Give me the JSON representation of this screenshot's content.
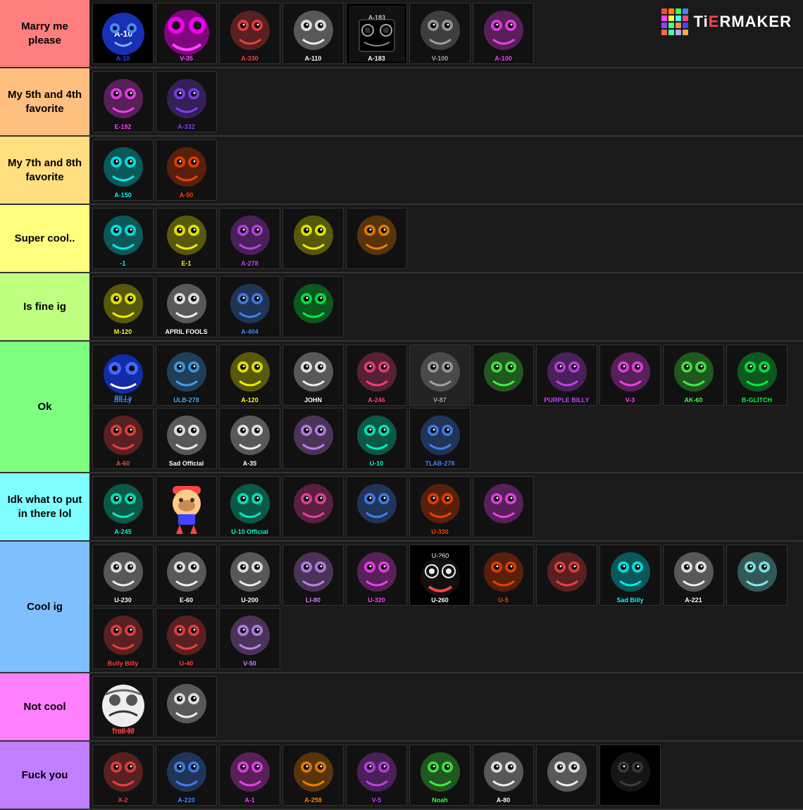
{
  "logo": {
    "text": "TiERMAKER",
    "highlight": "T"
  },
  "tiers": [
    {
      "id": "marry",
      "label": "Marry me please",
      "color": "#ff7f7f",
      "items": [
        {
          "id": "a10",
          "label": "A-10",
          "color": "#2244ff",
          "bg": "#000"
        },
        {
          "id": "v35",
          "label": "V-35",
          "color": "#ff44ff",
          "bg": "#111"
        },
        {
          "id": "a330",
          "label": "A-330",
          "color": "#ff4444",
          "bg": "#111"
        },
        {
          "id": "a110",
          "label": "A-110",
          "color": "#ffffff",
          "bg": "#111"
        },
        {
          "id": "a183",
          "label": "A-183",
          "color": "#ffffff",
          "bg": "#000"
        },
        {
          "id": "v100b",
          "label": "V-100",
          "color": "#aaaaaa",
          "bg": "#111"
        },
        {
          "id": "a100",
          "label": "A-100",
          "color": "#ff44ff",
          "bg": "#111"
        }
      ]
    },
    {
      "id": "5th4th",
      "label": "My 5th and 4th favorite",
      "color": "#ffbf7f",
      "items": [
        {
          "id": "e192",
          "label": "E-192",
          "color": "#ff44ff",
          "bg": "#111"
        },
        {
          "id": "a332",
          "label": "A-332",
          "color": "#8844ff",
          "bg": "#111"
        }
      ]
    },
    {
      "id": "7th8th",
      "label": "My 7th and 8th favorite",
      "color": "#ffdf80",
      "items": [
        {
          "id": "a150",
          "label": "A-150",
          "color": "#00ffff",
          "bg": "#111"
        },
        {
          "id": "a50",
          "label": "A-50",
          "color": "#ff4400",
          "bg": "#111"
        }
      ]
    },
    {
      "id": "supercool",
      "label": "Super cool..",
      "color": "#ffff7f",
      "items": [
        {
          "id": "neg1",
          "label": "-1",
          "color": "#00ffff",
          "bg": "#111"
        },
        {
          "id": "e1",
          "label": "E-1",
          "color": "#ffff00",
          "bg": "#111"
        },
        {
          "id": "a278",
          "label": "A-278",
          "color": "#cc44ff",
          "bg": "#111"
        },
        {
          "id": "smiley",
          "label": "",
          "color": "#ffff00",
          "bg": "#111"
        },
        {
          "id": "orange_cone",
          "label": "",
          "color": "#ff8800",
          "bg": "#111"
        }
      ]
    },
    {
      "id": "isfinig",
      "label": "Is fine ig",
      "color": "#bfff7f",
      "items": [
        {
          "id": "m120",
          "label": "M-120",
          "color": "#ffff00",
          "bg": "#111"
        },
        {
          "id": "april",
          "label": "APRIL FOOLS",
          "color": "#ffffff",
          "bg": "#111"
        },
        {
          "id": "a404",
          "label": "A-404",
          "color": "#4488ff",
          "bg": "#111"
        },
        {
          "id": "green_face",
          "label": "",
          "color": "#00ff44",
          "bg": "#111"
        }
      ]
    },
    {
      "id": "ok",
      "label": "Ok",
      "color": "#7fff7f",
      "items": [
        {
          "id": "billy",
          "label": "BILLy",
          "color": "#4488ff",
          "bg": "#111"
        },
        {
          "id": "ulb278",
          "label": "ULB-278",
          "color": "#44aaff",
          "bg": "#111"
        },
        {
          "id": "a120",
          "label": "A-120",
          "color": "#ffff00",
          "bg": "#111"
        },
        {
          "id": "john",
          "label": "JOHN",
          "color": "#ffffff",
          "bg": "#111"
        },
        {
          "id": "a246",
          "label": "A-246",
          "color": "#ff4488",
          "bg": "#111"
        },
        {
          "id": "v87",
          "label": "V-87",
          "color": "#aaaaaa",
          "bg": "#222"
        },
        {
          "id": "xx1",
          "label": "",
          "color": "#44ff44",
          "bg": "#111"
        },
        {
          "id": "purple_billy",
          "label": "PURPLE BILLY",
          "color": "#cc44ff",
          "bg": "#111"
        },
        {
          "id": "v3",
          "label": "V-3",
          "color": "#ff44ff",
          "bg": "#111"
        },
        {
          "id": "ak60",
          "label": "AK-60",
          "color": "#44ff44",
          "bg": "#111"
        },
        {
          "id": "b_glitch",
          "label": "B-GLITCH",
          "color": "#00ff44",
          "bg": "#111"
        },
        {
          "id": "a60",
          "label": "A-60",
          "color": "#ff4444",
          "bg": "#111"
        },
        {
          "id": "sad_official",
          "label": "Sad Official",
          "color": "#ffffff",
          "bg": "#111"
        },
        {
          "id": "a35",
          "label": "A-35",
          "color": "#ffffff",
          "bg": "#111"
        },
        {
          "id": "jk21",
          "label": "",
          "color": "#cc88ff",
          "bg": "#111"
        },
        {
          "id": "u10ok",
          "label": "U-10",
          "color": "#00ffcc",
          "bg": "#111"
        },
        {
          "id": "tlab278",
          "label": "TLAB-278",
          "color": "#4488ff",
          "bg": "#111"
        }
      ]
    },
    {
      "id": "idkwhat",
      "label": "Idk what to put in there lol",
      "color": "#7fffff",
      "items": [
        {
          "id": "a245",
          "label": "A-245",
          "color": "#00ffcc",
          "bg": "#111"
        },
        {
          "id": "mario",
          "label": "",
          "color": "#ff4444",
          "bg": "#111"
        },
        {
          "id": "u10off",
          "label": "U-10 Official",
          "color": "#00ffcc",
          "bg": "#111"
        },
        {
          "id": "idk4",
          "label": "",
          "color": "#ff44aa",
          "bg": "#111"
        },
        {
          "id": "idk5",
          "label": "",
          "color": "#4488ff",
          "bg": "#111"
        },
        {
          "id": "idk6",
          "label": "U-330",
          "color": "#ff4400",
          "bg": "#111"
        },
        {
          "id": "idk7",
          "label": "",
          "color": "#ff44ff",
          "bg": "#111"
        }
      ]
    },
    {
      "id": "coolig",
      "label": "Cool ig",
      "color": "#7fbfff",
      "items": [
        {
          "id": "u230",
          "label": "U-230",
          "color": "#ffffff",
          "bg": "#111"
        },
        {
          "id": "e60",
          "label": "E-60",
          "color": "#ffffff",
          "bg": "#111"
        },
        {
          "id": "u200",
          "label": "U-200",
          "color": "#ffffff",
          "bg": "#111"
        },
        {
          "id": "li80",
          "label": "LI-80",
          "color": "#cc88ff",
          "bg": "#111"
        },
        {
          "id": "u320",
          "label": "U-320",
          "color": "#ff44ff",
          "bg": "#111"
        },
        {
          "id": "u260",
          "label": "U-260",
          "color": "#ffffff",
          "bg": "#000"
        },
        {
          "id": "u5top",
          "label": "U-5",
          "color": "#ff4400",
          "bg": "#111"
        },
        {
          "id": "red_sm",
          "label": "",
          "color": "#ff4444",
          "bg": "#111"
        },
        {
          "id": "sad_billy",
          "label": "Sad Billy",
          "color": "#00ffff",
          "bg": "#111"
        },
        {
          "id": "a221",
          "label": "A-221",
          "color": "#ffffff",
          "bg": "#111"
        },
        {
          "id": "eyes_cl",
          "label": "",
          "color": "#88ffff",
          "bg": "#111"
        },
        {
          "id": "bully_billy",
          "label": "Bully Billy",
          "color": "#ff4444",
          "bg": "#111"
        },
        {
          "id": "u40",
          "label": "U-40",
          "color": "#ff4444",
          "bg": "#111"
        },
        {
          "id": "v50",
          "label": "V-50",
          "color": "#cc88ff",
          "bg": "#111"
        }
      ]
    },
    {
      "id": "notcool",
      "label": "Not cool",
      "color": "#ff7fff",
      "items": [
        {
          "id": "troll90",
          "label": "Troll-90",
          "color": "#ff4444",
          "bg": "#111"
        },
        {
          "id": "xx2",
          "label": "",
          "color": "#ffffff",
          "bg": "#111"
        }
      ]
    },
    {
      "id": "fuckyou",
      "label": "Fuck you",
      "color": "#bf7fff",
      "items": [
        {
          "id": "x2",
          "label": "X-2",
          "color": "#ff4444",
          "bg": "#111"
        },
        {
          "id": "a220",
          "label": "A-220",
          "color": "#4488ff",
          "bg": "#111"
        },
        {
          "id": "a1",
          "label": "A-1",
          "color": "#ff44ff",
          "bg": "#111"
        },
        {
          "id": "a258",
          "label": "A-258",
          "color": "#ff8800",
          "bg": "#111"
        },
        {
          "id": "v5",
          "label": "V-5",
          "color": "#cc44ff",
          "bg": "#111"
        },
        {
          "id": "noah",
          "label": "Noah",
          "color": "#44ff44",
          "bg": "#111"
        },
        {
          "id": "a80",
          "label": "A-80",
          "color": "#ffffff",
          "bg": "#111"
        },
        {
          "id": "troll2",
          "label": "",
          "color": "#ffffff",
          "bg": "#111"
        },
        {
          "id": "dark_last",
          "label": "",
          "color": "#444",
          "bg": "#000"
        }
      ]
    }
  ]
}
